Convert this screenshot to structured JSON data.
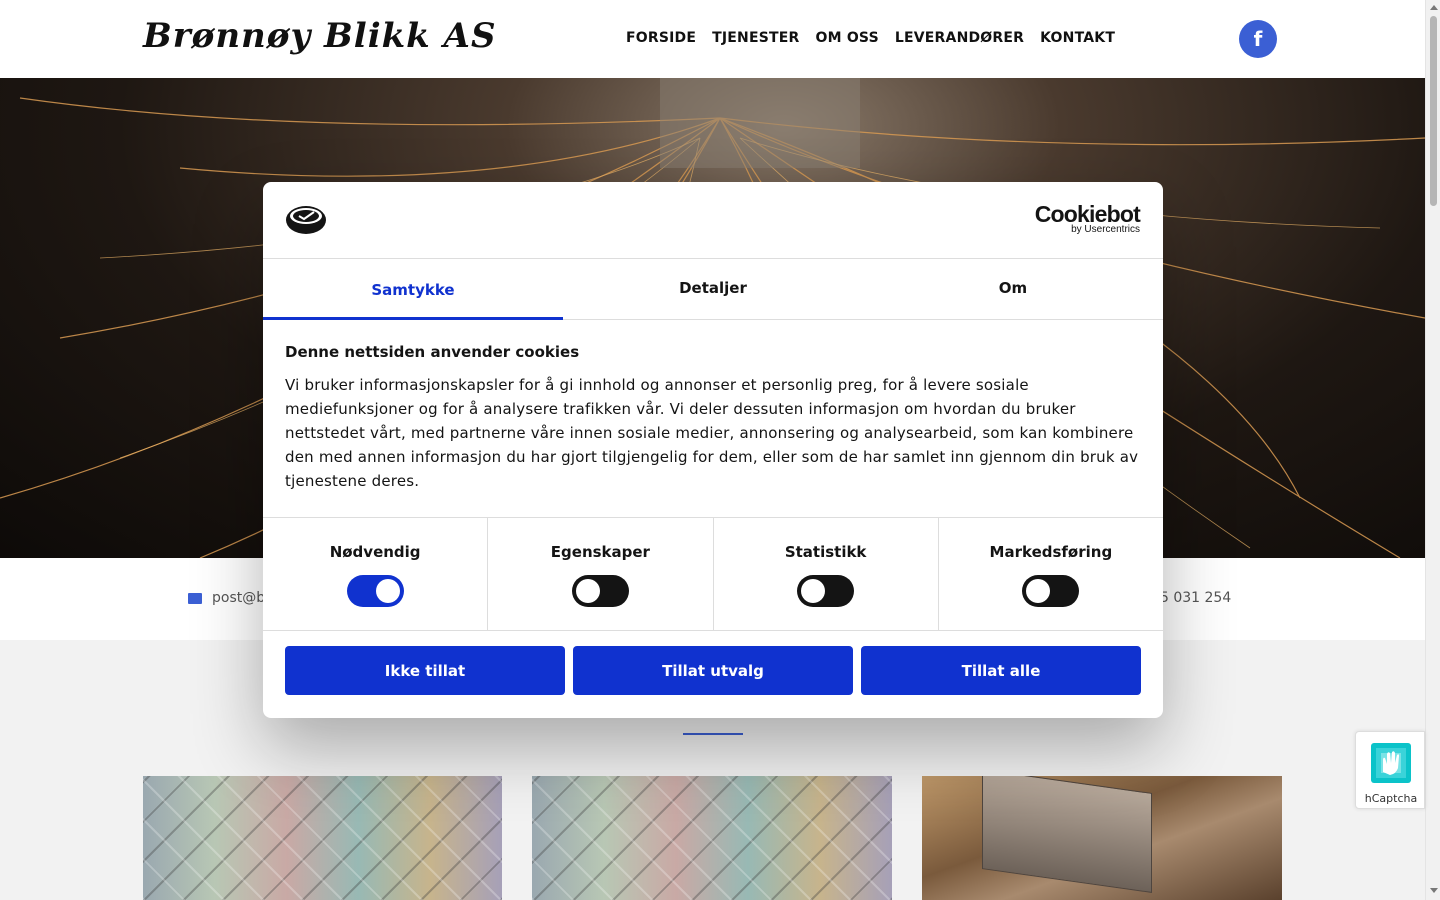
{
  "site": {
    "logo_text": "Brønnøy Blikk AS",
    "nav": [
      "FORSIDE",
      "TJENESTER",
      "OM OSS",
      "LEVERANDØRER",
      "KONTAKT"
    ],
    "facebook_icon": "facebook-icon",
    "brand_color": "#3b5fd4"
  },
  "contact": {
    "email_partial": "post@br",
    "phone_partial": "5 031 254"
  },
  "cookie_dialog": {
    "brand_name": "Cookiebot",
    "brand_sub": "by Usercentrics",
    "tabs": [
      {
        "label": "Samtykke",
        "active": true
      },
      {
        "label": "Detaljer",
        "active": false
      },
      {
        "label": "Om",
        "active": false
      }
    ],
    "title": "Denne nettsiden anvender cookies",
    "body": "Vi bruker informasjonskapsler for å gi innhold og annonser et personlig preg, for å levere sosiale mediefunksjoner og for å analysere trafikken vår. Vi deler dessuten informasjon om hvordan du bruker nettstedet vårt, med partnerne våre innen sosiale medier, annonsering og analysearbeid, som kan kombinere den med annen informasjon du har gjort tilgjengelig for dem, eller som de har samlet inn gjennom din bruk av tjenestene deres.",
    "categories": [
      {
        "label": "Nødvendig",
        "enabled": true
      },
      {
        "label": "Egenskaper",
        "enabled": false
      },
      {
        "label": "Statistikk",
        "enabled": false
      },
      {
        "label": "Markedsføring",
        "enabled": false
      }
    ],
    "buttons": {
      "deny": "Ikke tillat",
      "allow_selection": "Tillat utvalg",
      "allow_all": "Tillat alle"
    },
    "accent_color": "#1032cf"
  },
  "hcaptcha": {
    "label": "hCaptcha"
  }
}
